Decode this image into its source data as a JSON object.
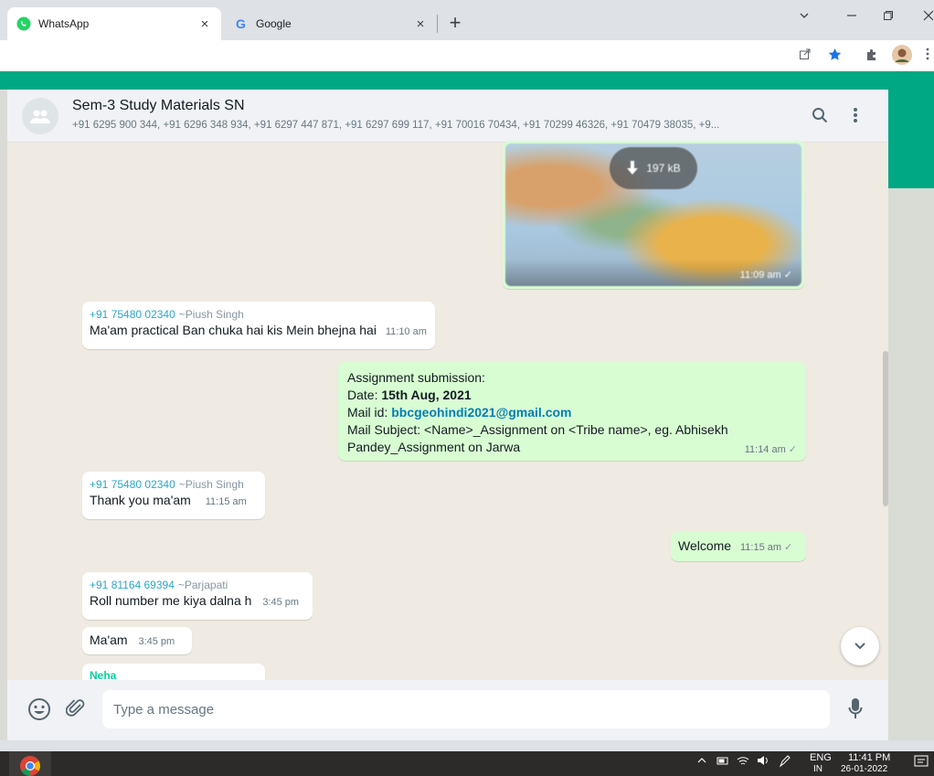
{
  "browser": {
    "tabs": [
      {
        "title": "WhatsApp",
        "active": true,
        "icon": "whatsapp-icon"
      },
      {
        "title": "Google",
        "active": false,
        "icon": "google-icon"
      }
    ],
    "tab_close": "×",
    "new_tab": "+"
  },
  "chat": {
    "title": "Sem-3  Study Materials SN",
    "participants": "+91 6295 900 344, +91 6296 348 934, +91 6297 447 871, +91 6297 699 117, +91 70016 70434, +91 70299 46326, +91 70479 38035, +9..."
  },
  "messages": {
    "image": {
      "size": "197 kB",
      "time": "11:09 am"
    },
    "m1": {
      "sender_number": "+91 75480 02340",
      "sender_name": "~Piush Singh",
      "text": "Ma'am practical Ban chuka hai kis Mein bhejna hai",
      "time": "11:10 am"
    },
    "m2": {
      "line1": "Assignment submission:",
      "date_label": "Date: ",
      "date_value": "15th Aug, 2021",
      "mail_label": "Mail id: ",
      "mail_value": "bbcgeohindi2021@gmail.com",
      "subject": "Mail Subject: <Name>_Assignment on <Tribe name>, eg. Abhisekh Pandey_Assignment on Jarwa",
      "time": "11:14 am"
    },
    "m3": {
      "sender_number": "+91 75480 02340",
      "sender_name": "~Piush Singh",
      "text": "Thank you ma'am",
      "time": "11:15 am"
    },
    "m4": {
      "text": "Welcome",
      "time": "11:15 am"
    },
    "m5": {
      "sender_number": "+91 81164 69394",
      "sender_name": "~Parjapati",
      "text": "Roll number me kiya dalna h",
      "time": "3:45 pm"
    },
    "m6": {
      "text": "Ma'am",
      "time": "3:45 pm"
    },
    "m7": {
      "sender_partial": "Neha"
    }
  },
  "compose": {
    "placeholder": "Type a message"
  },
  "taskbar": {
    "lang": "ENG",
    "region": "IN",
    "time": "11:41 PM",
    "date": "26-01-2022"
  },
  "colors": {
    "accent": "#00a884",
    "outgoing": "#d9fdd3",
    "chat_bg": "#efeae2"
  }
}
